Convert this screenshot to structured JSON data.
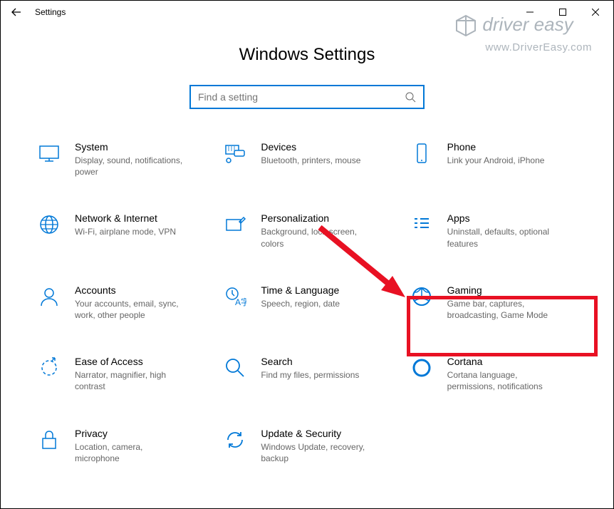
{
  "window": {
    "title": "Settings"
  },
  "page": {
    "heading": "Windows Settings"
  },
  "search": {
    "placeholder": "Find a setting"
  },
  "tiles": [
    {
      "title": "System",
      "desc": "Display, sound, notifications, power"
    },
    {
      "title": "Devices",
      "desc": "Bluetooth, printers, mouse"
    },
    {
      "title": "Phone",
      "desc": "Link your Android, iPhone"
    },
    {
      "title": "Network & Internet",
      "desc": "Wi-Fi, airplane mode, VPN"
    },
    {
      "title": "Personalization",
      "desc": "Background, lock screen, colors"
    },
    {
      "title": "Apps",
      "desc": "Uninstall, defaults, optional features"
    },
    {
      "title": "Accounts",
      "desc": "Your accounts, email, sync, work, other people"
    },
    {
      "title": "Time & Language",
      "desc": "Speech, region, date"
    },
    {
      "title": "Gaming",
      "desc": "Game bar, captures, broadcasting, Game Mode"
    },
    {
      "title": "Ease of Access",
      "desc": "Narrator, magnifier, high contrast"
    },
    {
      "title": "Search",
      "desc": "Find my files, permissions"
    },
    {
      "title": "Cortana",
      "desc": "Cortana language, permissions, notifications"
    },
    {
      "title": "Privacy",
      "desc": "Location, camera, microphone"
    },
    {
      "title": "Update & Security",
      "desc": "Windows Update, recovery, backup"
    }
  ],
  "watermark": {
    "brand": "driver easy",
    "url": "www.DriverEasy.com"
  }
}
